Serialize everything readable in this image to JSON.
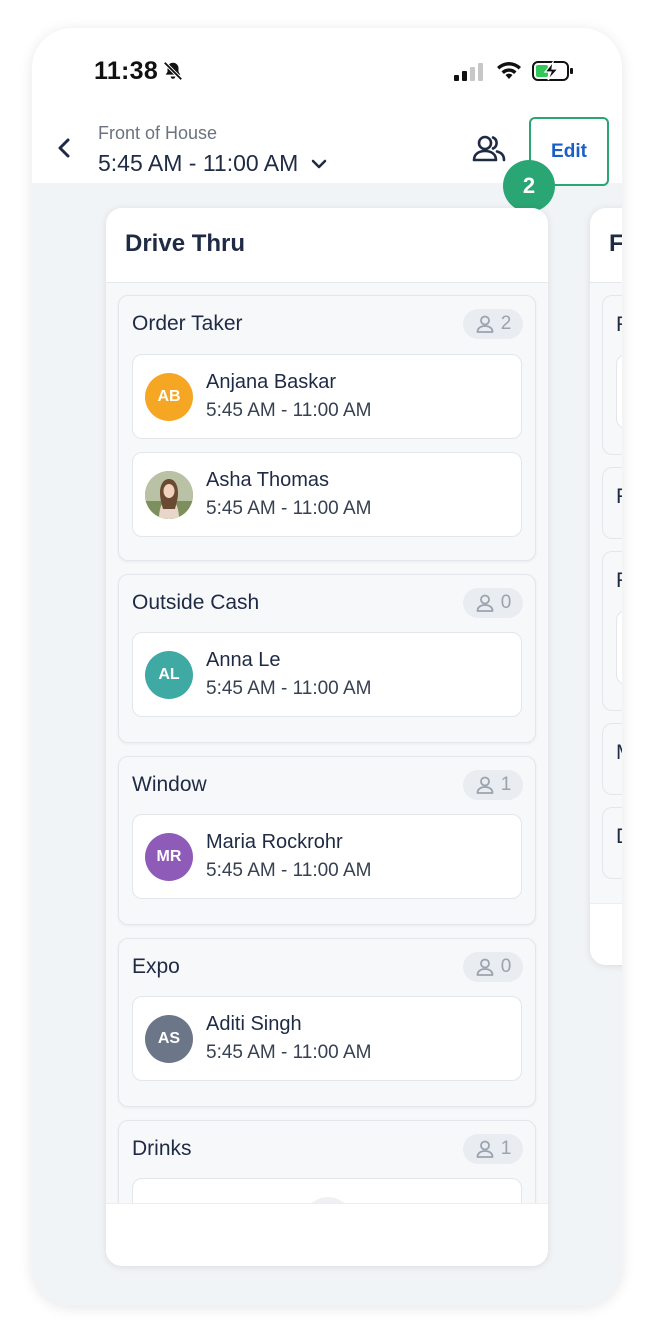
{
  "status_bar": {
    "time": "11:38",
    "icons": [
      "bell-off-icon",
      "signal-icon",
      "wifi-icon",
      "battery-charging-icon"
    ]
  },
  "header": {
    "department": "Front of House",
    "shift": "5:45 AM - 11:00 AM",
    "edit_label": "Edit",
    "step_badge": "2"
  },
  "station": {
    "title": "Drive Thru",
    "roles": [
      {
        "name": "Order Taker",
        "count": "2",
        "people": [
          {
            "initials": "AB",
            "name": "Anjana Baskar",
            "time": "5:45 AM - 11:00 AM",
            "color": "#f5a623"
          },
          {
            "initials": "",
            "name": "Asha Thomas",
            "time": "5:45 AM - 11:00 AM",
            "color": "#8b7b6b"
          }
        ]
      },
      {
        "name": "Outside Cash",
        "count": "0",
        "people": [
          {
            "initials": "AL",
            "name": "Anna Le",
            "time": "5:45 AM - 11:00 AM",
            "color": "#3fa9a3"
          }
        ]
      },
      {
        "name": "Window",
        "count": "1",
        "people": [
          {
            "initials": "MR",
            "name": "Maria Rockrohr",
            "time": "5:45 AM - 11:00 AM",
            "color": "#8e5bb8"
          }
        ]
      },
      {
        "name": "Expo",
        "count": "0",
        "people": [
          {
            "initials": "AS",
            "name": "Aditi Singh",
            "time": "5:45 AM - 11:00 AM",
            "color": "#6b7689"
          }
        ]
      },
      {
        "name": "Drinks",
        "count": "1",
        "people": []
      }
    ]
  },
  "next_station": {
    "title_initial": "F",
    "role_initials": [
      "F",
      "F",
      "F",
      "M",
      "D"
    ]
  }
}
